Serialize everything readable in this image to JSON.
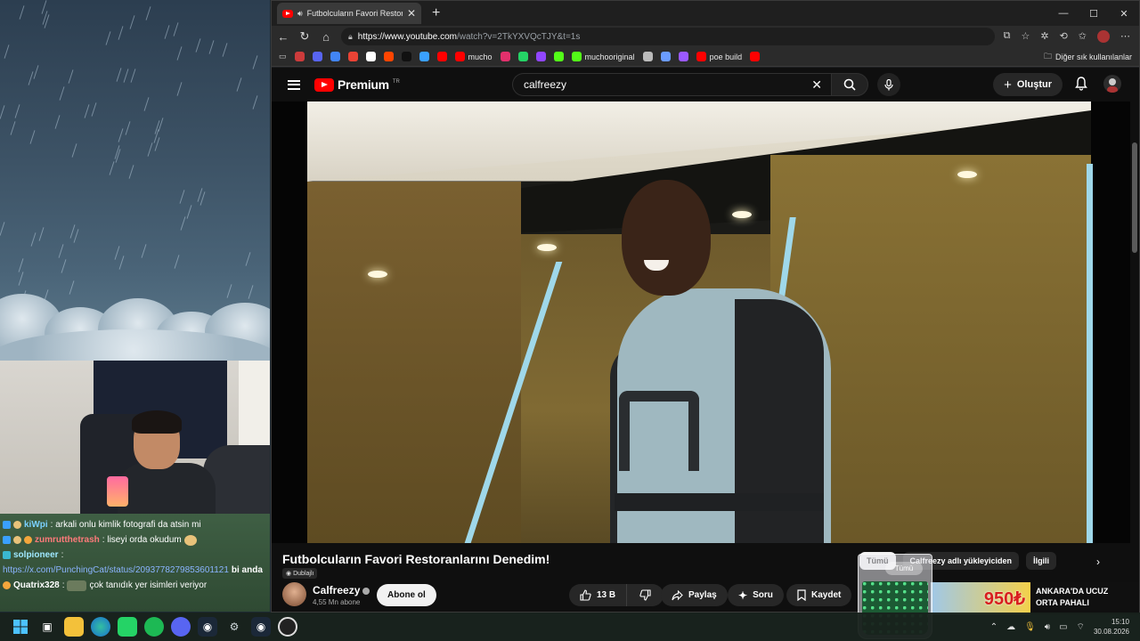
{
  "browser": {
    "tab_title": "Futbolcuların Favori Restoranl",
    "url_host": "https://www.youtube.com",
    "url_path": "/watch?v=2TkYXVQcTJY&t=1s",
    "bookmarks": [
      {
        "label": "",
        "color": "#cc3b3b"
      },
      {
        "label": "",
        "color": "#5865f2"
      },
      {
        "label": "",
        "color": "#4285f4"
      },
      {
        "label": "",
        "color": "#ea4335"
      },
      {
        "label": "",
        "color": "#ffffff"
      },
      {
        "label": "",
        "color": "#ff4500"
      },
      {
        "label": "",
        "color": "#111111"
      },
      {
        "label": "",
        "color": "#3aa0ff"
      },
      {
        "label": "",
        "color": "#ff0000"
      },
      {
        "label": "mucho",
        "color": "#ff0000"
      },
      {
        "label": "",
        "color": "#e1306c"
      },
      {
        "label": "",
        "color": "#25d366"
      },
      {
        "label": "",
        "color": "#9146ff"
      },
      {
        "label": "",
        "color": "#53fc18"
      },
      {
        "label": "muchooriginal",
        "color": "#53fc18"
      },
      {
        "label": "",
        "color": "#bbbbbb"
      },
      {
        "label": "",
        "color": "#6b9cff"
      },
      {
        "label": "",
        "color": "#9b59ff"
      },
      {
        "label": "poe build",
        "color": "#ff0000"
      },
      {
        "label": "",
        "color": "#ff0000"
      }
    ],
    "other_bookmarks": "Diğer sık kullanılanlar"
  },
  "youtube": {
    "logo_text": "Premium",
    "logo_region": "TR",
    "search_value": "calfreezy",
    "create_label": "Oluştur",
    "video_title": "Futbolcuların Favori Restoranlarını Denedim!",
    "dub_label": "Dublajlı",
    "channel_name": "Calfreezy",
    "subscribers": "4,55 Mn abone",
    "subscribe_label": "Abone ol",
    "like_count": "13 B",
    "share_label": "Paylaş",
    "ask_label": "Soru",
    "save_label": "Kaydet",
    "chips": [
      "Tümü",
      "Calfreezy adlı yükleyiciden",
      "İlgili"
    ],
    "ad_price": "950₺",
    "ad_text_line1": "ANKARA'DA UCUZ",
    "ad_text_line2": "ORTA PAHALI"
  },
  "chat": [
    {
      "user": "kiWpi",
      "user_color": "#7ad0ff",
      "message": ": arkali onlu kimlik fotografi da atsin mi"
    },
    {
      "user": "zumrutthetrash",
      "user_color": "#ff7a7a",
      "message": ": liseyi orda okudum"
    },
    {
      "user": "solpioneer",
      "user_color": "#9fe8ff",
      "message": ":"
    },
    {
      "user": "https://x.com/PunchingCat/status/2093778279853601121",
      "user_color": "#8ab4ff",
      "message": "bi anda"
    },
    {
      "user": "Quatrix328",
      "user_color": "#ffffff",
      "message": ":"
    },
    {
      "user": "",
      "user_color": "#ffffff",
      "message": "çok tanıdık yer isimleri veriyor"
    }
  ],
  "taskbar": {
    "time": "15:10",
    "date": "30.08.2026"
  }
}
